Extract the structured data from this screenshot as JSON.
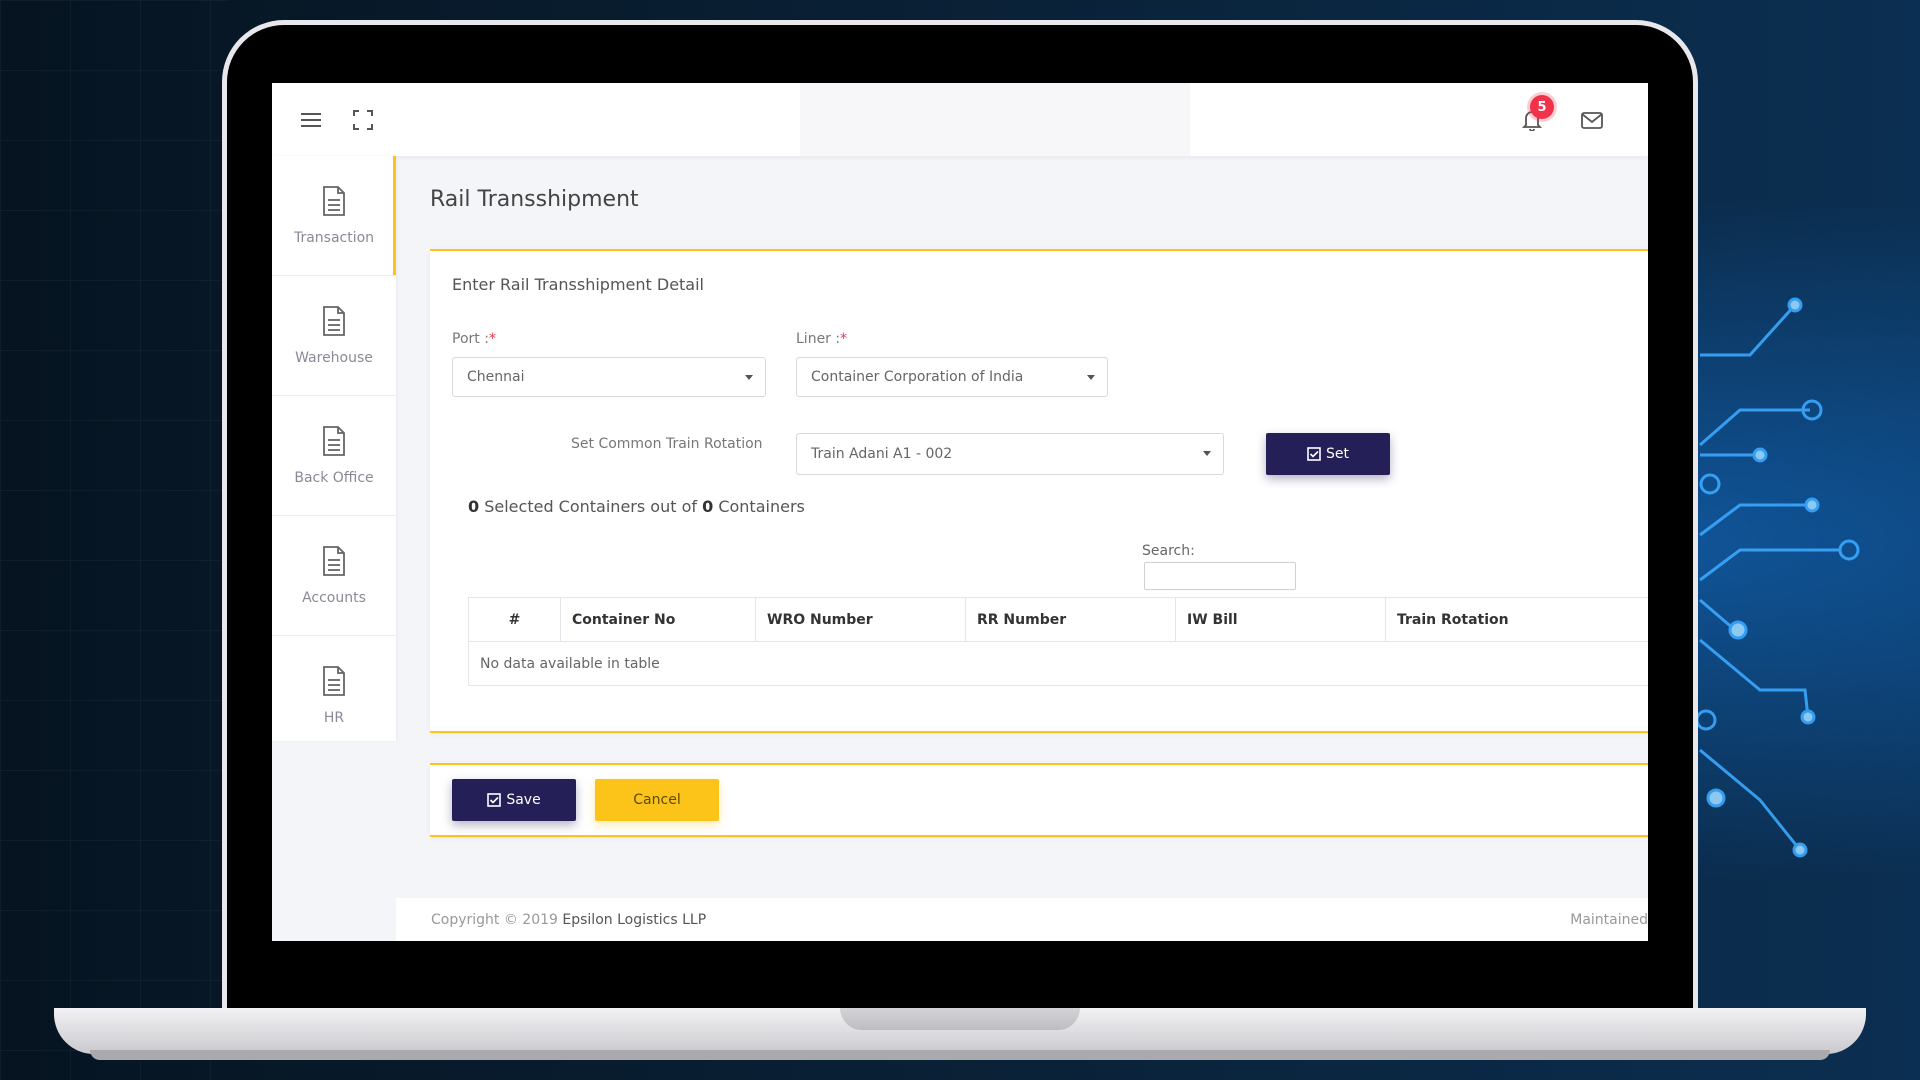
{
  "app": {
    "page_title": "Rail Transshipment",
    "notification_count": "5"
  },
  "sidebar": {
    "items": [
      {
        "label": "Transaction",
        "active": true
      },
      {
        "label": "Warehouse",
        "active": false
      },
      {
        "label": "Back Office",
        "active": false
      },
      {
        "label": "Accounts",
        "active": false
      },
      {
        "label": "HR",
        "active": false
      }
    ]
  },
  "form": {
    "title": "Enter Rail Transshipment Detail",
    "port_label": "Port :",
    "port_value": "Chennai",
    "liner_label": "Liner :",
    "liner_value": "Container Corporation of India",
    "required_mark": "*",
    "rotation_label": "Set Common Train Rotation",
    "rotation_value": "Train Adani A1 - 002",
    "set_label": "Set",
    "selected_count": "0",
    "selected_text_1": "Selected Containers out of",
    "total_count": "0",
    "selected_text_2": "Containers",
    "search_label": "Search:"
  },
  "table": {
    "columns": [
      "#",
      "Container No",
      "WRO Number",
      "RR Number",
      "IW Bill",
      "Train Rotation"
    ],
    "empty_text": "No data available in table"
  },
  "actions": {
    "save_label": "Save",
    "cancel_label": "Cancel"
  },
  "footer": {
    "copyright": "Copyright © 2019",
    "company": "Epsilon Logistics LLP",
    "right_text": "Maintained"
  },
  "colors": {
    "primary": "#242057",
    "accent": "#fcc419",
    "badge": "#f0324b"
  }
}
